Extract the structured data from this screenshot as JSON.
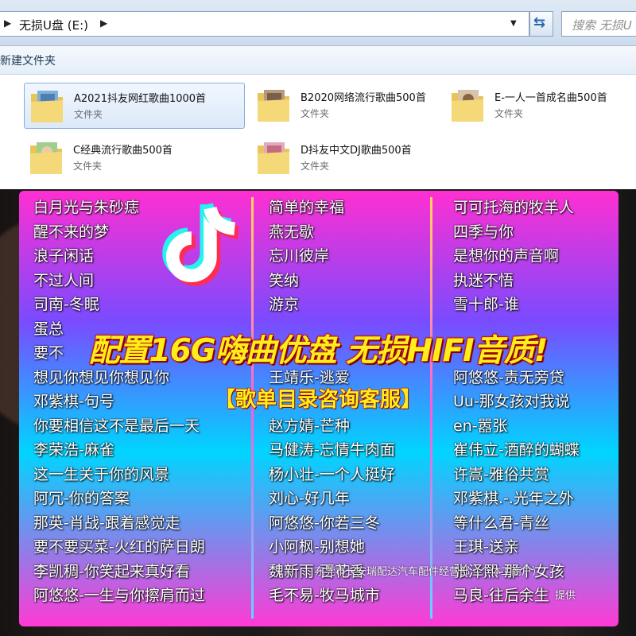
{
  "window": {
    "breadcrumb": "无损U盘 (E:)",
    "search_placeholder": "搜索 无损U",
    "toolbar": {
      "new_folder_label": "新建文件夹"
    }
  },
  "folders": [
    {
      "name": "A2021抖友网红歌曲1000首",
      "type": "文件夹",
      "selected": true
    },
    {
      "name": "B2020网络流行歌曲500首",
      "type": "文件夹",
      "selected": false
    },
    {
      "name": "E-一人一首成名曲500首",
      "type": "文件夹",
      "selected": false
    },
    {
      "name": "C经典流行歌曲500首",
      "type": "文件夹",
      "selected": false
    },
    {
      "name": "D抖友中文DJ歌曲500首",
      "type": "文件夹",
      "selected": false
    }
  ],
  "poster": {
    "headline": "配置16G嗨曲优盘 无损HIFI音质!",
    "subline": "【歌单目录咨询客服】",
    "merchant": "东莞市长安瑞配达汽车配件经营部（个体工商户）",
    "provider": "提供",
    "columns": [
      [
        "白月光与朱砂痣",
        "醒不来的梦",
        "浪子闲话",
        "不过人间",
        "司南-冬眠",
        "蛋总",
        "要不",
        "想见你想见你想见你",
        "邓紫棋-句号",
        "你要相信这不是最后一天",
        "李荣浩-麻雀",
        "这一生关于你的风景",
        "阿冗-你的答案",
        "那英-肖战-跟着感觉走",
        "要不要买菜-火红的萨日朗",
        "李凯稠-你笑起来真好看",
        "阿悠悠-一生与你擦肩而过"
      ],
      [
        "简单的幸福",
        "燕无歇",
        "忘川彼岸",
        "笑纳",
        "游京",
        "",
        "",
        "王靖乐-逃爱",
        "",
        "赵方婧-芒种",
        "马健涛-忘情牛肉面",
        "杨小壮-一个人挺好",
        "刘心-好几年",
        "阿悠悠-你若三冬",
        "小阿枫-别想她",
        "魏新雨-百花香",
        "毛不易-牧马城市"
      ],
      [
        "可可托海的牧羊人",
        "四季与你",
        "是想你的声音啊",
        "执迷不悟",
        "雪十郎-谁",
        "",
        "",
        "阿悠悠-责无旁贷",
        "Uu-那女孩对我说",
        "en-嚣张",
        "崔伟立-酒醉的蝴蝶",
        "许嵩-雅俗共赏",
        "邓紫棋.-.光年之外",
        "等什么君-青丝",
        "王琪-送亲",
        "张泽熙-那个女孩",
        "马良-往后余生"
      ]
    ]
  },
  "colors": {
    "headline": "#ffee1a",
    "outline": "#d91a0a",
    "tiktok_cyan": "#25f4ee",
    "tiktok_red": "#fe2c55"
  }
}
